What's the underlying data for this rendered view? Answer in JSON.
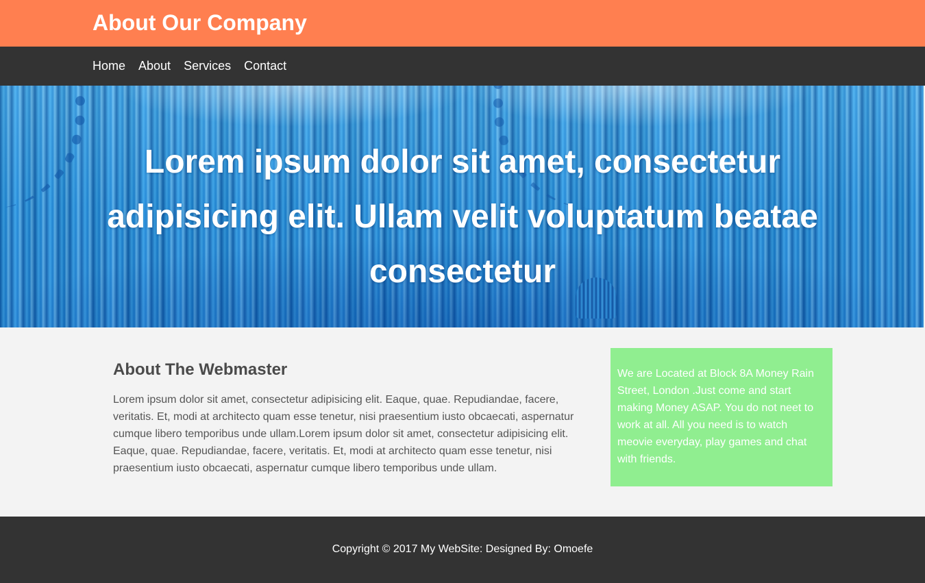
{
  "header": {
    "title": "About Our Company"
  },
  "nav": {
    "items": [
      {
        "label": "Home"
      },
      {
        "label": "About"
      },
      {
        "label": "Services"
      },
      {
        "label": "Contact"
      }
    ]
  },
  "hero": {
    "text": "Lorem ipsum dolor sit amet, consectetur adipisicing elit. Ullam velit voluptatum beatae consectetur"
  },
  "main": {
    "title": "About The Webmaster",
    "body": "Lorem ipsum dolor sit amet, consectetur adipisicing elit. Eaque, quae. Repudiandae, facere, veritatis. Et, modi at architecto quam esse tenetur, nisi praesentium iusto obcaecati, aspernatur cumque libero temporibus unde ullam.Lorem ipsum dolor sit amet, consectetur adipisicing elit. Eaque, quae. Repudiandae, facere, veritatis. Et, modi at architecto quam esse tenetur, nisi praesentium iusto obcaecati, aspernatur cumque libero temporibus unde ullam."
  },
  "aside": {
    "text": "We are Located at Block 8A Money Rain Street, London .Just come and start making Money ASAP. You do not neet to work at all. All you need is to watch meovie everyday, play games and chat with friends."
  },
  "footer": {
    "text": "Copyright © 2017 My WebSite: Designed By: Omoefe"
  },
  "colors": {
    "header_bg": "#ff7f50",
    "nav_bg": "#333333",
    "info_box_bg": "#90ee90",
    "page_bg": "#f3f3f3"
  }
}
